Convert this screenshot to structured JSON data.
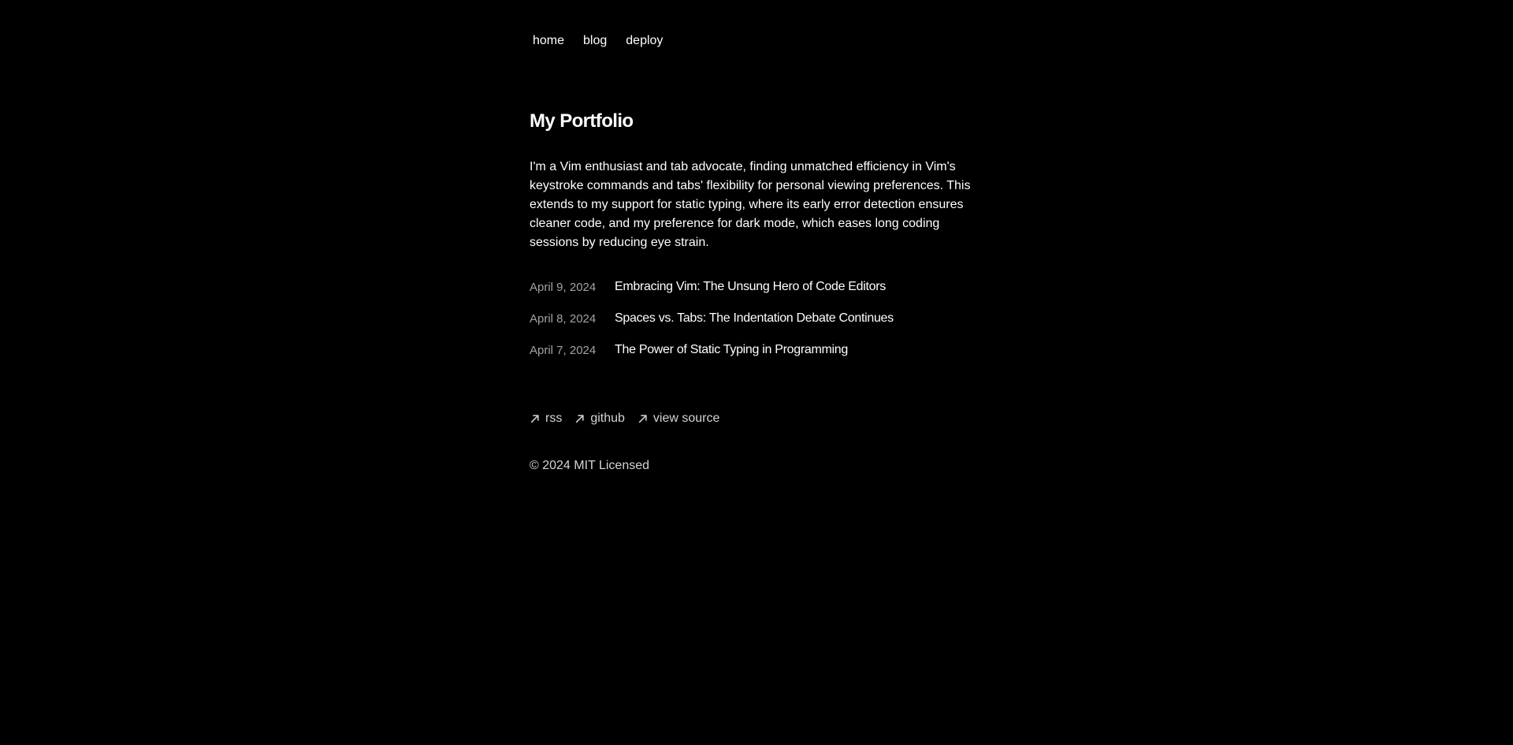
{
  "nav": {
    "items": [
      {
        "label": "home"
      },
      {
        "label": "blog"
      },
      {
        "label": "deploy"
      }
    ]
  },
  "main": {
    "title": "My Portfolio",
    "bio": "I'm a Vim enthusiast and tab advocate, finding unmatched efficiency in Vim's keystroke commands and tabs' flexibility for personal viewing preferences. This extends to my support for static typing, where its early error detection ensures cleaner code, and my preference for dark mode, which eases long coding sessions by reducing eye strain.",
    "posts": [
      {
        "date": "April 9, 2024",
        "title": "Embracing Vim: The Unsung Hero of Code Editors"
      },
      {
        "date": "April 8, 2024",
        "title": "Spaces vs. Tabs: The Indentation Debate Continues"
      },
      {
        "date": "April 7, 2024",
        "title": "The Power of Static Typing in Programming"
      }
    ]
  },
  "footer": {
    "links": [
      {
        "label": "rss",
        "icon": "arrow-up-right-icon"
      },
      {
        "label": "github",
        "icon": "arrow-up-right-icon"
      },
      {
        "label": "view source",
        "icon": "arrow-up-right-icon"
      }
    ],
    "copyright": "© 2024 MIT Licensed"
  },
  "colors": {
    "background": "#000000",
    "text": "#ffffff",
    "muted": "#a3a3a3",
    "footer_text": "#d4d4d4"
  }
}
